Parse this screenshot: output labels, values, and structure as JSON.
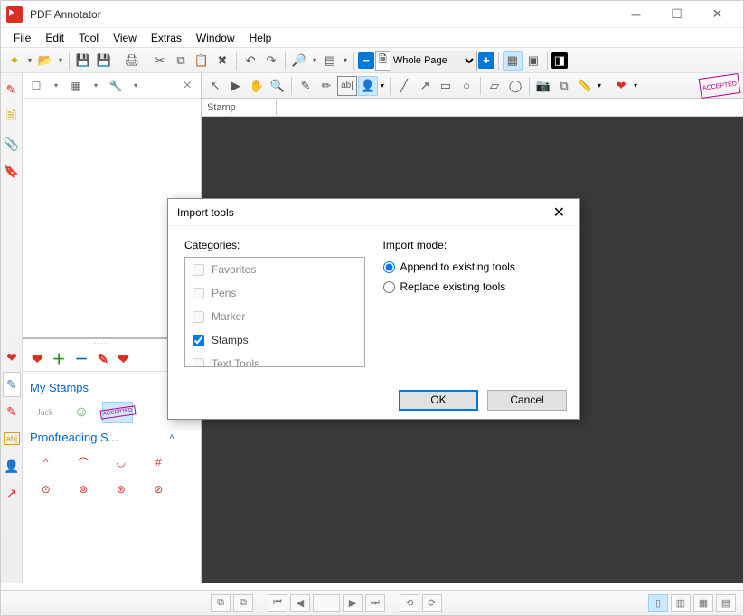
{
  "app": {
    "title": "PDF Annotator"
  },
  "menu": {
    "file": "File",
    "edit": "Edit",
    "tool": "Tool",
    "view": "View",
    "extras": "Extras",
    "window": "Window",
    "help": "Help"
  },
  "zoom": {
    "selected": "Whole Page"
  },
  "property": {
    "label": "Stamp"
  },
  "panel": {
    "dots": "·····",
    "my_stamps": "My Stamps",
    "proofreading": "Proofreading S...",
    "jack": "Jack",
    "accepted": "ACCEPTED"
  },
  "dialog": {
    "title": "Import tools",
    "categories_label": "Categories:",
    "import_mode_label": "Import mode:",
    "categories": [
      {
        "label": "Favorites",
        "checked": false,
        "enabled": false
      },
      {
        "label": "Pens",
        "checked": false,
        "enabled": false
      },
      {
        "label": "Marker",
        "checked": false,
        "enabled": false
      },
      {
        "label": "Stamps",
        "checked": true,
        "enabled": true
      },
      {
        "label": "Text Tools",
        "checked": false,
        "enabled": false
      }
    ],
    "mode_append": "Append to existing tools",
    "mode_replace": "Replace existing tools",
    "ok": "OK",
    "cancel": "Cancel"
  },
  "badge": {
    "accepted": "ACCEPTED"
  }
}
